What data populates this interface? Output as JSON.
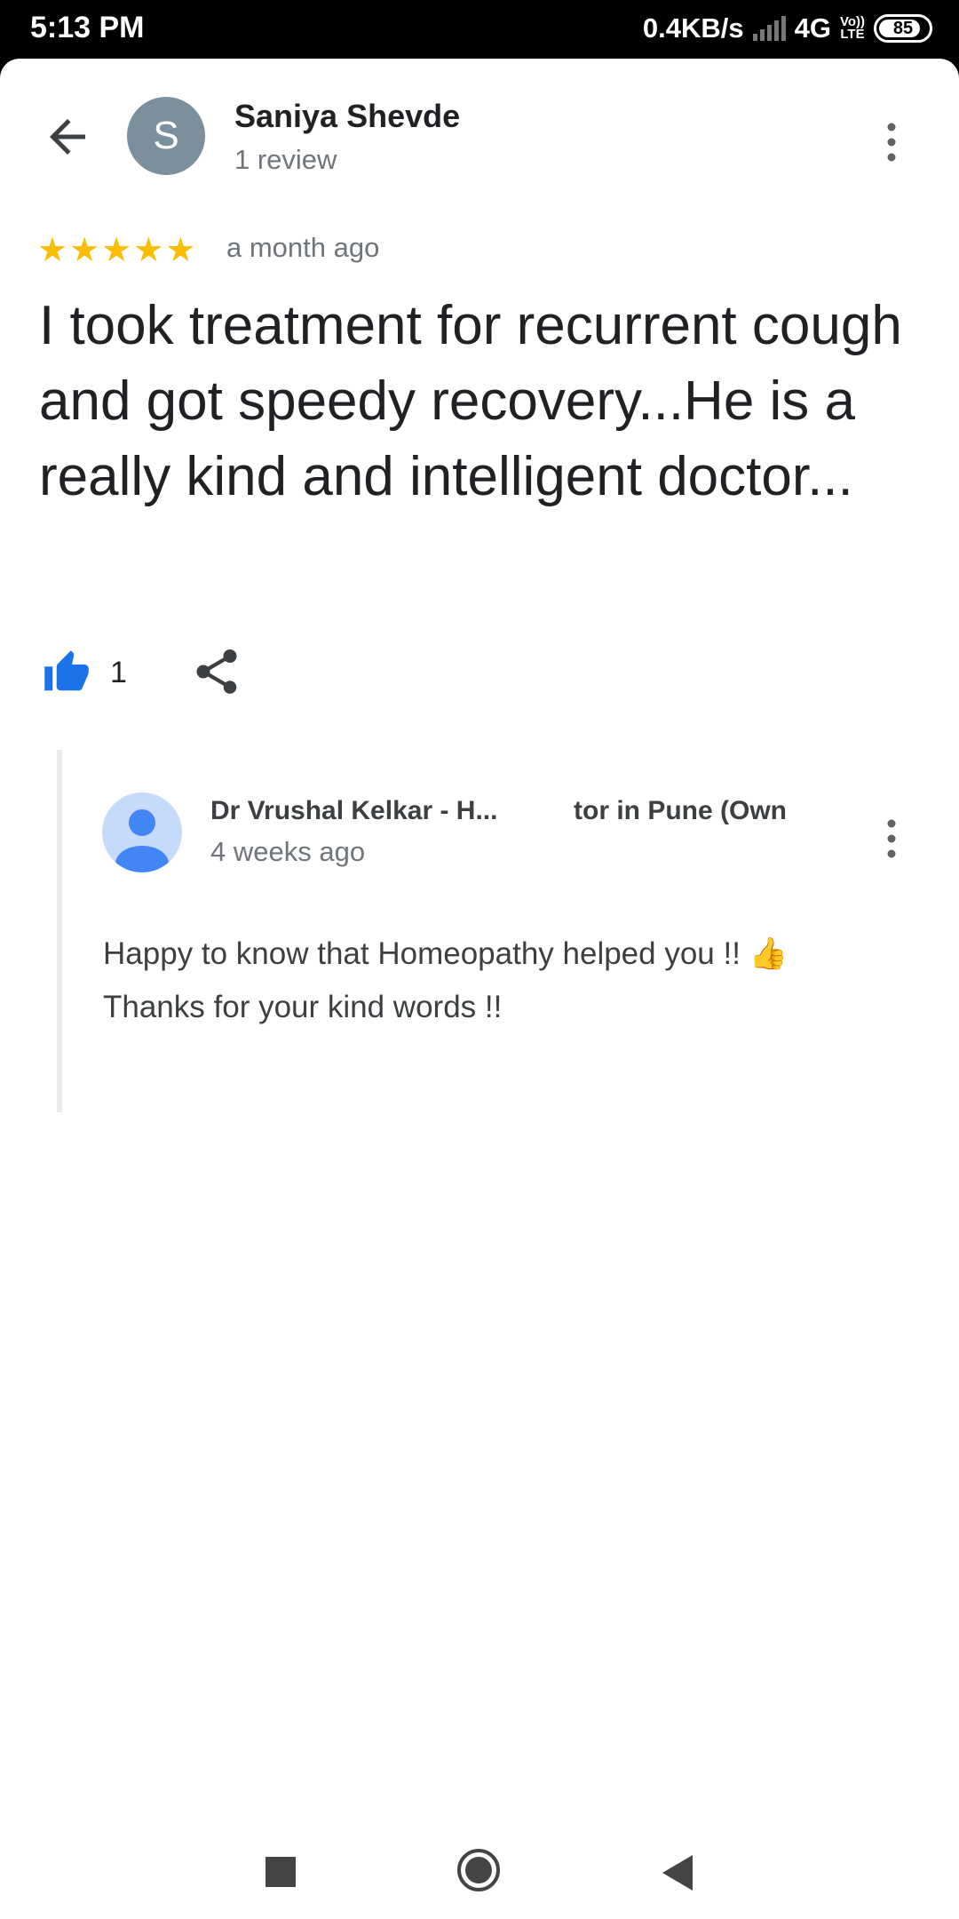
{
  "status_bar": {
    "time": "5:13 PM",
    "speed": "0.4KB/s",
    "network": "4G",
    "volte_top": "Vo))",
    "volte_bottom": "LTE",
    "battery": "85",
    "battery_level": 0.85
  },
  "review": {
    "reviewer_initial": "S",
    "reviewer_name": "Saniya Shevde",
    "reviewer_count": "1 review",
    "rating": 5,
    "time_ago": "a month ago",
    "text": "I took treatment for recurrent cough and got speedy recovery...He is a really kind and intelligent doctor...",
    "like_count": "1"
  },
  "reply": {
    "owner_name_part1": "Dr Vrushal Kelkar - H...",
    "owner_name_part2": "tor in Pune (Own",
    "time": "4 weeks ago",
    "text_line1": "Happy to know that Homeopathy helped you !! 👍",
    "text_line2": "Thanks for your kind words !!"
  },
  "colors": {
    "star": "#fbbc04",
    "like_icon": "#1a73e8",
    "avatar_s_bg": "#7b909c",
    "owner_avatar_bg": "#c6dafc"
  }
}
